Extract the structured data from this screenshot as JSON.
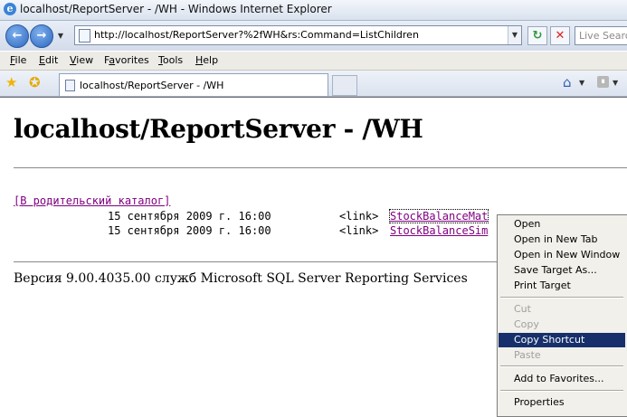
{
  "window": {
    "title": "localhost/ReportServer - /WH - Windows Internet Explorer",
    "logo": "e"
  },
  "address": {
    "url": "http://localhost/ReportServer?%2fWH&rs:Command=ListChildren"
  },
  "search": {
    "placeholder": "Live Search"
  },
  "menu": [
    {
      "label": "File",
      "key": "F",
      "rest": "ile"
    },
    {
      "label": "Edit",
      "key": "E",
      "rest": "dit"
    },
    {
      "label": "View",
      "key": "V",
      "rest": "iew"
    },
    {
      "label": "Favorites",
      "key": "a",
      "pre": "F",
      "rest": "vorites"
    },
    {
      "label": "Tools",
      "key": "T",
      "rest": "ools"
    },
    {
      "label": "Help",
      "key": "H",
      "rest": "elp"
    }
  ],
  "tab": {
    "label": "localhost/ReportServer - /WH"
  },
  "page": {
    "heading": "localhost/ReportServer - /WH",
    "parent_link": "[В родительский каталог]",
    "rows": [
      {
        "date": "15 сентября 2009 г. 16:00",
        "type": "<link>",
        "name": "StockBalanceMat"
      },
      {
        "date": "15 сентября 2009 г. 16:00",
        "type": "<link>",
        "name": "StockBalanceSim"
      }
    ],
    "footer": "Версия 9.00.4035.00 служб Microsoft SQL Server Reporting Services"
  },
  "context_menu": {
    "items": [
      {
        "label": "Open",
        "enabled": true
      },
      {
        "label": "Open in New Tab",
        "enabled": true
      },
      {
        "label": "Open in New Window",
        "enabled": true
      },
      {
        "label": "Save Target As...",
        "enabled": true
      },
      {
        "label": "Print Target",
        "enabled": true
      },
      {
        "label": "Cut",
        "enabled": false
      },
      {
        "label": "Copy",
        "enabled": false
      },
      {
        "label": "Copy Shortcut",
        "enabled": true,
        "selected": true
      },
      {
        "label": "Paste",
        "enabled": false
      },
      {
        "label": "Add to Favorites...",
        "enabled": true
      },
      {
        "label": "Properties",
        "enabled": true
      }
    ]
  },
  "colors": {
    "visited_link": "#800080",
    "menu_highlight": "#17306b",
    "disabled_text": "#a0a0a0"
  },
  "icons": [
    "ie-logo-icon",
    "back-icon",
    "forward-icon",
    "page-icon",
    "refresh-icon",
    "stop-icon",
    "favorites-star-icon",
    "add-favorites-icon",
    "home-icon",
    "feeds-icon"
  ]
}
